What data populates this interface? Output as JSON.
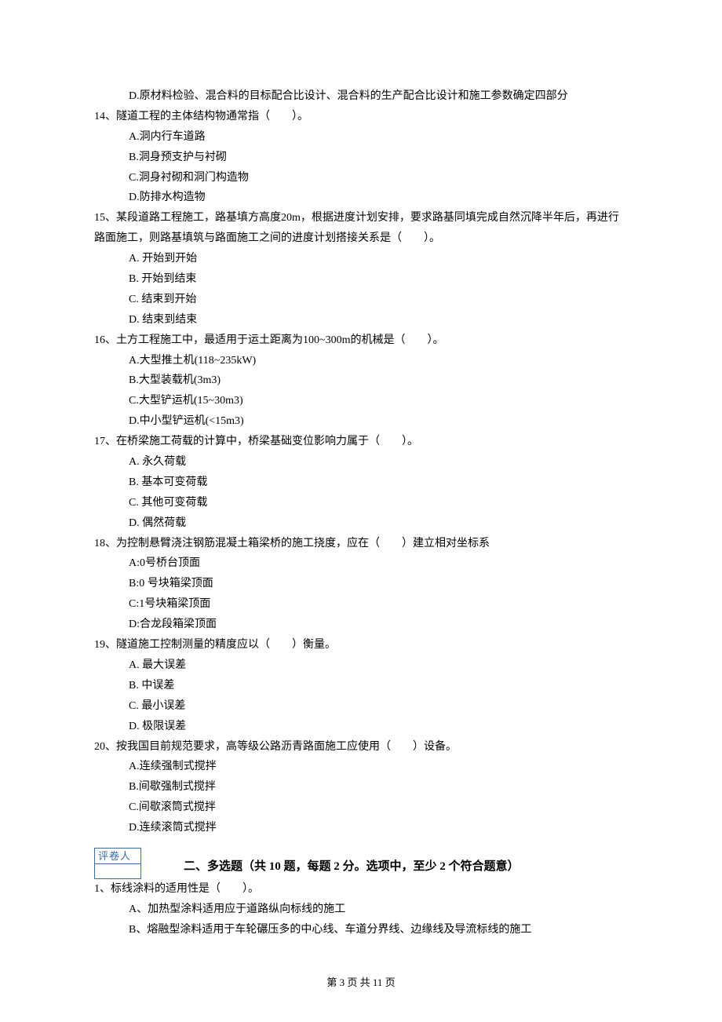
{
  "orphan_option_d": "D.原材料检验、混合料的目标配合比设计、混合料的生产配合比设计和施工参数确定四部分",
  "questions": [
    {
      "num": "14",
      "stem": "、隧道工程的主体结构物通常指（　　）。",
      "options": [
        "A.洞内行车道路",
        "B.洞身预支护与衬砌",
        "C.洞身衬砌和洞门构造物",
        "D.防排水构造物"
      ]
    },
    {
      "num": "15",
      "stem": "、某段道路工程施工，路基填方高度20m，根据进度计划安排，要求路基同填完成自然沉降半年后，再进行路面施工，则路基填筑与路面施工之间的进度计划搭接关系是（　　）。",
      "options": [
        "A. 开始到开始",
        "B. 开始到结束",
        "C. 结束到开始",
        "D. 结束到结束"
      ]
    },
    {
      "num": "16",
      "stem": "、土方工程施工中，最适用于运土距离为100~300m的机械是（　　）。",
      "options": [
        "A.大型推土机(118~235kW)",
        "B.大型装载机(3m3)",
        "C.大型铲运机(15~30m3)",
        "D.中小型铲运机(<15m3)"
      ]
    },
    {
      "num": "17",
      "stem": "、在桥梁施工荷载的计算中，桥梁基础变位影响力属于（　　）。",
      "options": [
        "A. 永久荷载",
        "B. 基本可变荷载",
        "C. 其他可变荷载",
        "D. 偶然荷载"
      ]
    },
    {
      "num": "18",
      "stem": "、为控制悬臂浇注钢筋混凝土箱梁桥的施工挠度，应在（　　）建立相对坐标系",
      "options": [
        "A:0号桥台顶面",
        "B:0 号块箱梁顶面",
        "C:1号块箱梁顶面",
        "D:合龙段箱梁顶面"
      ]
    },
    {
      "num": "19",
      "stem": "、隧道施工控制测量的精度应以（　　）衡量。",
      "options": [
        "A. 最大误差",
        "B. 中误差",
        "C. 最小误差",
        "D. 极限误差"
      ]
    },
    {
      "num": "20",
      "stem": "、按我国目前规范要求，高等级公路沥青路面施工应使用（　　）设备。",
      "options": [
        "A.连续强制式搅拌",
        "B.间歇强制式搅拌",
        "C.间歇滚筒式搅拌",
        "D.连续滚筒式搅拌"
      ]
    }
  ],
  "reviewer_label": "评卷人",
  "section2": {
    "title": "二、多选题（共 10 题，每题 2 分。选项中，至少 2 个符合题意）",
    "q1": {
      "num": "1",
      "stem": "、标线涂料的适用性是（　　）。",
      "options": [
        "A、加热型涂料适用应于道路纵向标线的施工",
        "B、熔融型涂料适用于车轮碾压多的中心线、车道分界线、边缘线及导流标线的施工"
      ]
    }
  },
  "footer": "第 3 页 共 11 页"
}
